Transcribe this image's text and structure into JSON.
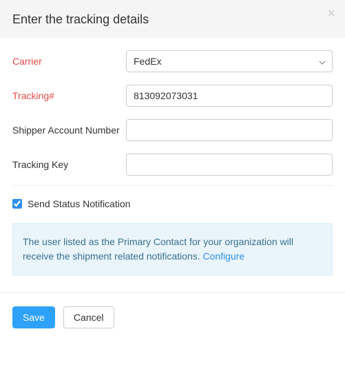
{
  "header": {
    "title": "Enter the tracking details"
  },
  "form": {
    "carrier": {
      "label": "Carrier",
      "value": "FedEx"
    },
    "tracking_number": {
      "label": "Tracking#",
      "value": "813092073031"
    },
    "shipper_account": {
      "label": "Shipper Account Number",
      "value": ""
    },
    "tracking_key": {
      "label": "Tracking Key",
      "value": ""
    }
  },
  "notification": {
    "checkbox_label": "Send Status Notification",
    "checked": true,
    "info_text": "The user listed as the Primary Contact for your organization will receive the shipment related notifications. ",
    "configure_label": "Configure"
  },
  "footer": {
    "save_label": "Save",
    "cancel_label": "Cancel"
  }
}
